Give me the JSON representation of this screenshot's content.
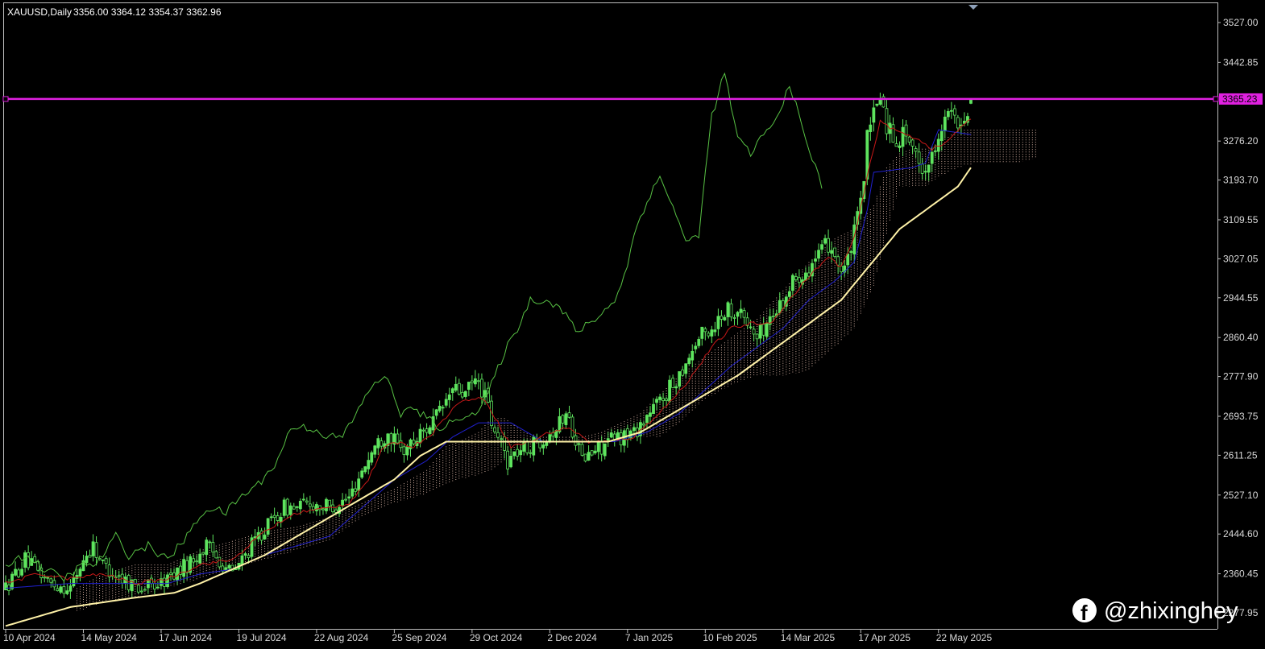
{
  "header": {
    "symbol": "XAUUSD,Daily",
    "ohlc": "3356.00 3364.12 3354.37 3362.96"
  },
  "watermark": {
    "handle": "@zhixinghey",
    "icon": "facebook-icon"
  },
  "colors": {
    "background": "#000000",
    "bull": "#5ee45e",
    "chikou": "#58c244",
    "tenkan": "#c81818",
    "kijun": "#2020d0",
    "ma": "#fff2a8",
    "cloud": "#f0c8b8",
    "hline": "#e020e0",
    "axis_text": "#d8d8d8"
  },
  "chart_data": {
    "type": "candlestick",
    "symbol": "XAUUSD",
    "timeframe": "Daily",
    "last_bar": {
      "open": 3356.0,
      "high": 3364.12,
      "low": 3354.37,
      "close": 3362.96
    },
    "y_ticks": [
      3527.0,
      3442.85,
      3276.2,
      3193.7,
      3109.55,
      3027.05,
      2944.55,
      2860.4,
      2777.9,
      2693.75,
      2611.25,
      2527.1,
      2444.6,
      2360.45,
      2277.95
    ],
    "y_tick_labels": [
      "3527.00",
      "3442.85",
      "3276.20",
      "3193.70",
      "3109.55",
      "3027.05",
      "2944.55",
      "2860.40",
      "2777.90",
      "2693.75",
      "2611.25",
      "2527.10",
      "2444.60",
      "2360.45",
      "2277.95"
    ],
    "y_range": [
      2268,
      3548
    ],
    "x_labels": [
      "10 Apr 2024",
      "14 May 2024",
      "17 Jun 2024",
      "19 Jul 2024",
      "22 Aug 2024",
      "25 Sep 2024",
      "29 Oct 2024",
      "2 Dec 2024",
      "7 Jan 2025",
      "10 Feb 2025",
      "14 Mar 2025",
      "17 Apr 2025",
      "22 May 2025"
    ],
    "x_label_bars": [
      0,
      24,
      48,
      72,
      96,
      120,
      144,
      168,
      192,
      216,
      240,
      264,
      288
    ],
    "horizontal_line": {
      "value": 3365.23,
      "label": "3365.23"
    },
    "close_anchors": [
      [
        0,
        2330
      ],
      [
        6,
        2390
      ],
      [
        14,
        2340
      ],
      [
        20,
        2330
      ],
      [
        24,
        2390
      ],
      [
        27,
        2420
      ],
      [
        30,
        2380
      ],
      [
        36,
        2350
      ],
      [
        42,
        2330
      ],
      [
        48,
        2340
      ],
      [
        52,
        2360
      ],
      [
        58,
        2390
      ],
      [
        62,
        2420
      ],
      [
        66,
        2390
      ],
      [
        70,
        2360
      ],
      [
        74,
        2400
      ],
      [
        78,
        2440
      ],
      [
        82,
        2470
      ],
      [
        86,
        2500
      ],
      [
        90,
        2500
      ],
      [
        94,
        2510
      ],
      [
        100,
        2500
      ],
      [
        106,
        2520
      ],
      [
        110,
        2580
      ],
      [
        114,
        2630
      ],
      [
        118,
        2660
      ],
      [
        122,
        2620
      ],
      [
        126,
        2640
      ],
      [
        130,
        2670
      ],
      [
        134,
        2700
      ],
      [
        138,
        2750
      ],
      [
        142,
        2740
      ],
      [
        145,
        2770
      ],
      [
        148,
        2740
      ],
      [
        151,
        2650
      ],
      [
        153,
        2640
      ],
      [
        155,
        2600
      ],
      [
        158,
        2620
      ],
      [
        162,
        2630
      ],
      [
        166,
        2650
      ],
      [
        170,
        2670
      ],
      [
        173,
        2700
      ],
      [
        176,
        2650
      ],
      [
        178,
        2600
      ],
      [
        182,
        2620
      ],
      [
        186,
        2640
      ],
      [
        190,
        2650
      ],
      [
        194,
        2660
      ],
      [
        200,
        2710
      ],
      [
        206,
        2760
      ],
      [
        210,
        2810
      ],
      [
        214,
        2860
      ],
      [
        218,
        2880
      ],
      [
        222,
        2920
      ],
      [
        226,
        2920
      ],
      [
        230,
        2880
      ],
      [
        232,
        2860
      ],
      [
        236,
        2900
      ],
      [
        240,
        2940
      ],
      [
        244,
        2990
      ],
      [
        248,
        3010
      ],
      [
        252,
        3040
      ],
      [
        254,
        3060
      ],
      [
        256,
        3040
      ],
      [
        258,
        3000
      ],
      [
        260,
        3020
      ],
      [
        262,
        3080
      ],
      [
        264,
        3140
      ],
      [
        266,
        3280
      ],
      [
        268,
        3330
      ],
      [
        270,
        3380
      ],
      [
        272,
        3310
      ],
      [
        274,
        3290
      ],
      [
        276,
        3280
      ],
      [
        278,
        3300
      ],
      [
        280,
        3250
      ],
      [
        282,
        3230
      ],
      [
        284,
        3220
      ],
      [
        286,
        3240
      ],
      [
        288,
        3300
      ],
      [
        290,
        3320
      ],
      [
        292,
        3340
      ],
      [
        294,
        3290
      ],
      [
        296,
        3330
      ],
      [
        298,
        3362.96
      ]
    ],
    "tenkan_anchors": [
      [
        0,
        2340
      ],
      [
        10,
        2360
      ],
      [
        20,
        2350
      ],
      [
        30,
        2360
      ],
      [
        40,
        2340
      ],
      [
        50,
        2350
      ],
      [
        60,
        2380
      ],
      [
        70,
        2390
      ],
      [
        80,
        2450
      ],
      [
        90,
        2490
      ],
      [
        100,
        2500
      ],
      [
        106,
        2510
      ],
      [
        112,
        2560
      ],
      [
        116,
        2620
      ],
      [
        120,
        2640
      ],
      [
        126,
        2630
      ],
      [
        132,
        2660
      ],
      [
        138,
        2710
      ],
      [
        142,
        2730
      ],
      [
        148,
        2730
      ],
      [
        152,
        2680
      ],
      [
        156,
        2630
      ],
      [
        162,
        2640
      ],
      [
        168,
        2660
      ],
      [
        174,
        2670
      ],
      [
        180,
        2640
      ],
      [
        186,
        2640
      ],
      [
        194,
        2650
      ],
      [
        200,
        2690
      ],
      [
        206,
        2730
      ],
      [
        212,
        2780
      ],
      [
        218,
        2840
      ],
      [
        224,
        2880
      ],
      [
        230,
        2890
      ],
      [
        236,
        2890
      ],
      [
        242,
        2940
      ],
      [
        248,
        2990
      ],
      [
        254,
        3030
      ],
      [
        258,
        3010
      ],
      [
        262,
        3070
      ],
      [
        266,
        3200
      ],
      [
        270,
        3320
      ],
      [
        274,
        3300
      ],
      [
        278,
        3290
      ],
      [
        282,
        3280
      ],
      [
        286,
        3260
      ],
      [
        290,
        3270
      ],
      [
        294,
        3300
      ],
      [
        298,
        3320
      ]
    ],
    "kijun_anchors": [
      [
        0,
        2330
      ],
      [
        20,
        2340
      ],
      [
        36,
        2340
      ],
      [
        50,
        2340
      ],
      [
        60,
        2360
      ],
      [
        70,
        2370
      ],
      [
        80,
        2400
      ],
      [
        90,
        2420
      ],
      [
        100,
        2440
      ],
      [
        110,
        2500
      ],
      [
        120,
        2560
      ],
      [
        130,
        2600
      ],
      [
        138,
        2650
      ],
      [
        146,
        2680
      ],
      [
        156,
        2680
      ],
      [
        166,
        2640
      ],
      [
        176,
        2640
      ],
      [
        188,
        2640
      ],
      [
        198,
        2660
      ],
      [
        208,
        2700
      ],
      [
        216,
        2750
      ],
      [
        224,
        2800
      ],
      [
        232,
        2840
      ],
      [
        240,
        2880
      ],
      [
        248,
        2940
      ],
      [
        256,
        2980
      ],
      [
        262,
        3020
      ],
      [
        266,
        3130
      ],
      [
        268,
        3210
      ],
      [
        280,
        3220
      ],
      [
        284,
        3230
      ],
      [
        288,
        3300
      ],
      [
        298,
        3290
      ]
    ],
    "ma_anchors": [
      [
        0,
        2250
      ],
      [
        20,
        2290
      ],
      [
        40,
        2310
      ],
      [
        52,
        2320
      ],
      [
        60,
        2340
      ],
      [
        70,
        2370
      ],
      [
        80,
        2400
      ],
      [
        90,
        2440
      ],
      [
        100,
        2480
      ],
      [
        110,
        2520
      ],
      [
        120,
        2560
      ],
      [
        128,
        2610
      ],
      [
        136,
        2640
      ],
      [
        146,
        2640
      ],
      [
        156,
        2640
      ],
      [
        166,
        2640
      ],
      [
        176,
        2640
      ],
      [
        186,
        2640
      ],
      [
        196,
        2660
      ],
      [
        206,
        2700
      ],
      [
        216,
        2740
      ],
      [
        226,
        2780
      ],
      [
        234,
        2820
      ],
      [
        242,
        2860
      ],
      [
        250,
        2900
      ],
      [
        258,
        2940
      ],
      [
        264,
        2990
      ],
      [
        270,
        3040
      ],
      [
        276,
        3090
      ],
      [
        282,
        3120
      ],
      [
        288,
        3150
      ],
      [
        294,
        3180
      ],
      [
        298,
        3220
      ]
    ],
    "chikou_anchors": [
      [
        0,
        2380
      ],
      [
        6,
        2400
      ],
      [
        12,
        2370
      ],
      [
        18,
        2350
      ],
      [
        24,
        2380
      ],
      [
        28,
        2380
      ],
      [
        34,
        2440
      ],
      [
        38,
        2400
      ],
      [
        44,
        2420
      ],
      [
        50,
        2390
      ],
      [
        56,
        2440
      ],
      [
        62,
        2500
      ],
      [
        68,
        2490
      ],
      [
        72,
        2520
      ],
      [
        78,
        2550
      ],
      [
        84,
        2600
      ],
      [
        88,
        2670
      ],
      [
        94,
        2670
      ],
      [
        100,
        2650
      ],
      [
        104,
        2650
      ],
      [
        110,
        2720
      ],
      [
        114,
        2770
      ],
      [
        118,
        2770
      ],
      [
        122,
        2700
      ],
      [
        126,
        2710
      ],
      [
        130,
        2690
      ],
      [
        134,
        2670
      ],
      [
        138,
        2680
      ],
      [
        142,
        2700
      ],
      [
        146,
        2700
      ],
      [
        150,
        2760
      ],
      [
        154,
        2830
      ],
      [
        158,
        2880
      ],
      [
        162,
        2940
      ],
      [
        166,
        2940
      ],
      [
        170,
        2930
      ],
      [
        174,
        2900
      ],
      [
        176,
        2870
      ],
      [
        180,
        2890
      ],
      [
        184,
        2910
      ],
      [
        188,
        2940
      ],
      [
        192,
        3010
      ],
      [
        194,
        3080
      ],
      [
        198,
        3150
      ],
      [
        202,
        3200
      ],
      [
        206,
        3140
      ],
      [
        210,
        3060
      ],
      [
        214,
        3080
      ],
      [
        218,
        3330
      ],
      [
        222,
        3420
      ],
      [
        226,
        3280
      ],
      [
        230,
        3250
      ],
      [
        234,
        3290
      ],
      [
        238,
        3320
      ],
      [
        242,
        3400
      ],
      [
        246,
        3300
      ],
      [
        250,
        3220
      ],
      [
        252,
        3180
      ]
    ],
    "cloud_a_anchors": [
      [
        22,
        2330
      ],
      [
        30,
        2360
      ],
      [
        40,
        2380
      ],
      [
        50,
        2380
      ],
      [
        60,
        2410
      ],
      [
        70,
        2430
      ],
      [
        80,
        2450
      ],
      [
        90,
        2460
      ],
      [
        100,
        2480
      ],
      [
        110,
        2510
      ],
      [
        120,
        2540
      ],
      [
        130,
        2580
      ],
      [
        136,
        2630
      ],
      [
        140,
        2640
      ],
      [
        146,
        2660
      ],
      [
        150,
        2690
      ],
      [
        154,
        2690
      ],
      [
        160,
        2660
      ],
      [
        166,
        2650
      ],
      [
        172,
        2650
      ],
      [
        178,
        2650
      ],
      [
        184,
        2660
      ],
      [
        190,
        2680
      ],
      [
        196,
        2700
      ],
      [
        202,
        2740
      ],
      [
        208,
        2780
      ],
      [
        216,
        2820
      ],
      [
        224,
        2860
      ],
      [
        232,
        2900
      ],
      [
        240,
        2960
      ],
      [
        248,
        3020
      ],
      [
        256,
        3070
      ],
      [
        262,
        3090
      ],
      [
        268,
        3140
      ],
      [
        272,
        3220
      ],
      [
        276,
        3250
      ],
      [
        280,
        3260
      ],
      [
        284,
        3260
      ],
      [
        288,
        3270
      ],
      [
        294,
        3300
      ],
      [
        300,
        3300
      ],
      [
        306,
        3300
      ],
      [
        312,
        3300
      ],
      [
        318,
        3300
      ]
    ],
    "cloud_b_anchors": [
      [
        22,
        2280
      ],
      [
        30,
        2300
      ],
      [
        40,
        2310
      ],
      [
        50,
        2330
      ],
      [
        60,
        2350
      ],
      [
        70,
        2370
      ],
      [
        80,
        2390
      ],
      [
        90,
        2410
      ],
      [
        100,
        2430
      ],
      [
        110,
        2480
      ],
      [
        120,
        2510
      ],
      [
        130,
        2530
      ],
      [
        136,
        2550
      ],
      [
        140,
        2560
      ],
      [
        146,
        2570
      ],
      [
        150,
        2580
      ],
      [
        154,
        2600
      ],
      [
        160,
        2620
      ],
      [
        166,
        2640
      ],
      [
        172,
        2640
      ],
      [
        178,
        2640
      ],
      [
        184,
        2640
      ],
      [
        190,
        2650
      ],
      [
        196,
        2650
      ],
      [
        202,
        2650
      ],
      [
        208,
        2680
      ],
      [
        216,
        2730
      ],
      [
        224,
        2760
      ],
      [
        232,
        2780
      ],
      [
        240,
        2780
      ],
      [
        248,
        2790
      ],
      [
        256,
        2840
      ],
      [
        262,
        2880
      ],
      [
        268,
        2970
      ],
      [
        272,
        3080
      ],
      [
        276,
        3180
      ],
      [
        280,
        3180
      ],
      [
        284,
        3180
      ],
      [
        288,
        3200
      ],
      [
        294,
        3220
      ],
      [
        300,
        3230
      ],
      [
        306,
        3230
      ],
      [
        312,
        3230
      ],
      [
        318,
        3240
      ]
    ]
  }
}
